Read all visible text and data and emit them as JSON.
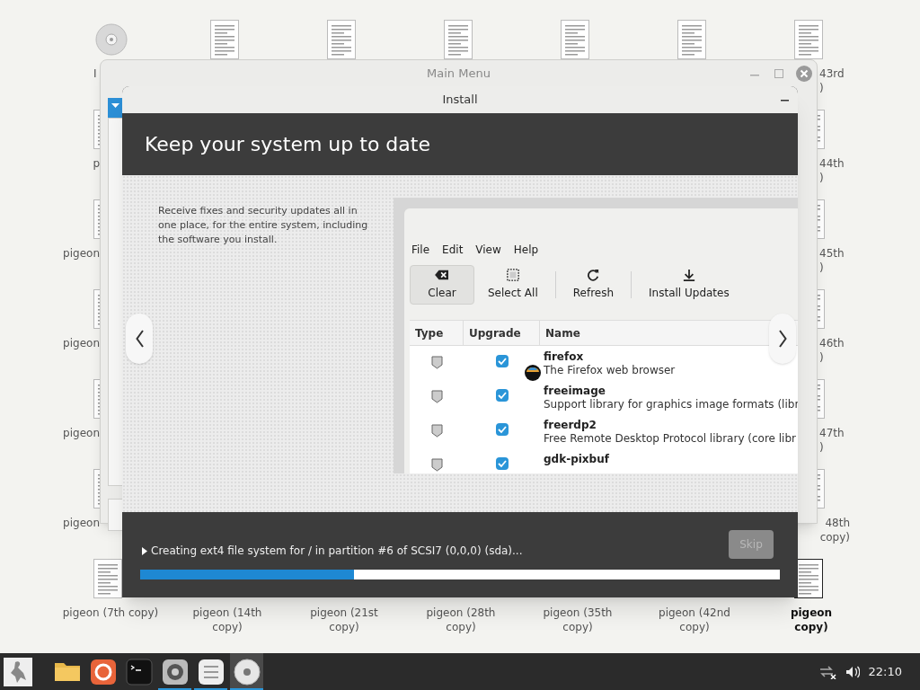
{
  "desktop_icons": [
    {
      "kind": "disc",
      "label": [
        "I"
      ]
    },
    {
      "kind": "document"
    },
    {
      "kind": "document"
    },
    {
      "kind": "document"
    },
    {
      "kind": "document"
    },
    {
      "kind": "document"
    },
    {
      "kind": "document",
      "label": [
        "43rd",
        ")"
      ]
    },
    {
      "kind": "document",
      "label": [
        "p"
      ]
    },
    {
      "kind": "document",
      "label": [
        "pigeon"
      ]
    },
    {
      "kind": "document",
      "label": [
        "pigeon"
      ]
    },
    {
      "kind": "document",
      "label": [
        "pigeon"
      ]
    },
    {
      "kind": "document",
      "label": [
        "pigeon"
      ]
    },
    {
      "kind": "document",
      "label": [
        "44th",
        ")"
      ]
    },
    {
      "kind": "document",
      "label": [
        "45th",
        ")"
      ]
    },
    {
      "kind": "document",
      "label": [
        "46th",
        ")"
      ]
    },
    {
      "kind": "document",
      "label": [
        "47th",
        ")"
      ]
    },
    {
      "kind": "document",
      "label": [
        "48th",
        "copy)"
      ]
    },
    {
      "kind": "document",
      "label": [
        "pigeon (7th copy)"
      ]
    },
    {
      "label": [
        "pigeon (14th",
        "copy)"
      ]
    },
    {
      "label": [
        "pigeon (21st",
        "copy)"
      ]
    },
    {
      "label": [
        "pigeon (28th",
        "copy)"
      ]
    },
    {
      "label": [
        "pigeon (35th",
        "copy)"
      ]
    },
    {
      "label": [
        "pigeon (42nd",
        "copy)"
      ]
    },
    {
      "kind": "document",
      "label": [
        "pigeon",
        "copy)"
      ],
      "selected": true
    }
  ],
  "main_window": {
    "title": "Main Menu"
  },
  "install_window": {
    "title": "Install",
    "heading": "Keep your system up to date",
    "description": "Receive fixes and security updates all in one place, for the entire system, including the software you install.",
    "screenshot": {
      "menu": [
        "File",
        "Edit",
        "View",
        "Help"
      ],
      "toolbar": [
        {
          "kind": "clear",
          "label": "Clear",
          "pressed": true
        },
        {
          "kind": "select",
          "label": "Select All",
          "pressed": false
        },
        {
          "kind": "refresh",
          "label": "Refresh",
          "pressed": false
        },
        {
          "kind": "download",
          "label": "Install Updates",
          "pressed": false
        }
      ],
      "columns": [
        "Type",
        "Upgrade",
        "Name"
      ],
      "rows": [
        {
          "checked": true,
          "app_icon": true,
          "name": "firefox",
          "description": "The Firefox web browser"
        },
        {
          "checked": true,
          "app_icon": false,
          "name": "freeimage",
          "description": "Support library for graphics image formats (libr"
        },
        {
          "checked": true,
          "app_icon": false,
          "name": "freerdp2",
          "description": "Free Remote Desktop Protocol library (core libr"
        },
        {
          "checked": true,
          "app_icon": false,
          "name": "gdk-pixbuf"
        }
      ]
    },
    "status": "Creating ext4 file system for / in partition #6 of SCSI7 (0,0,0) (sda)...",
    "skip_button": {
      "label": "Skip",
      "disabled": true
    },
    "progress": {
      "level": 0.334
    }
  },
  "taskbar": {
    "apps": [
      {
        "kind": "folder",
        "running": false,
        "active": false
      },
      {
        "kind": "browser",
        "running": false,
        "active": false
      },
      {
        "kind": "terminal",
        "running": false,
        "active": false
      },
      {
        "kind": "disk",
        "running": true,
        "active": false
      },
      {
        "kind": "list",
        "running": true,
        "active": false
      },
      {
        "kind": "disc",
        "running": true,
        "active": true
      }
    ],
    "clock": "22:10"
  }
}
